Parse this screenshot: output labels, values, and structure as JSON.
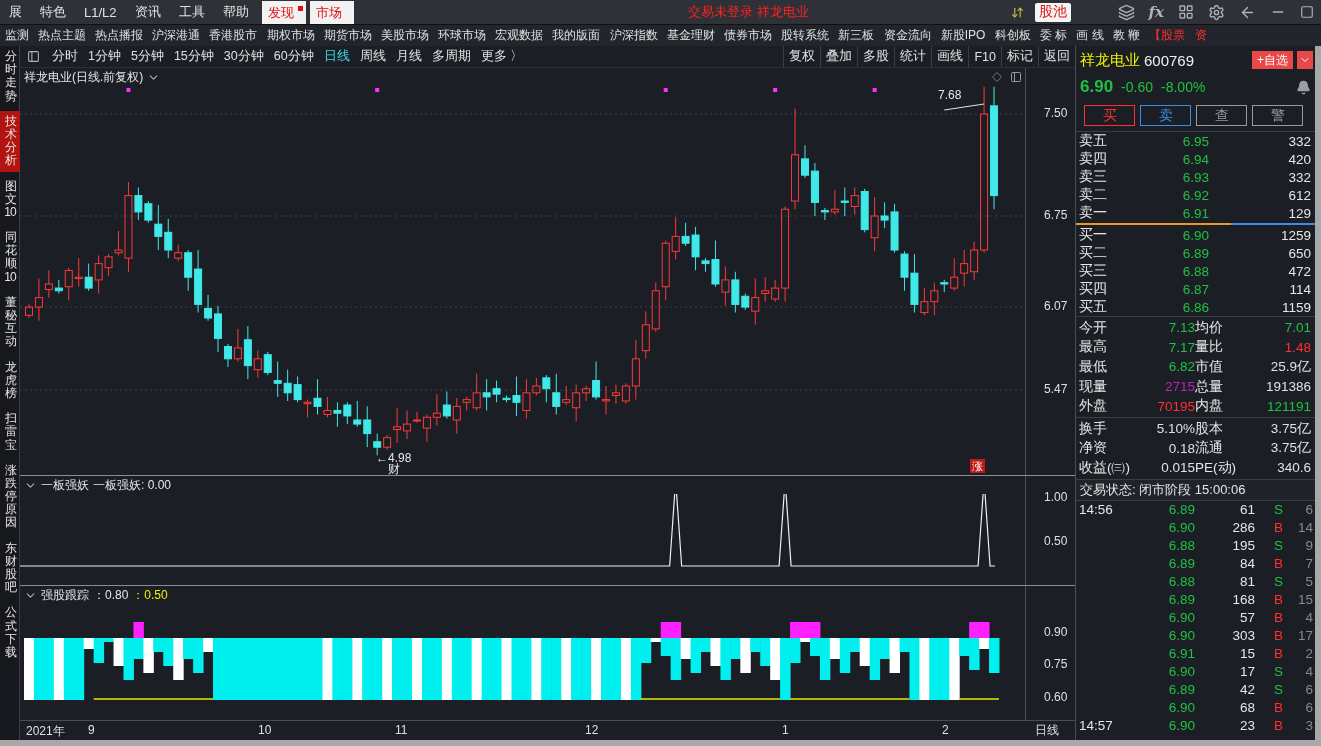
{
  "top_menu": {
    "items": [
      "展",
      "特色",
      "L1/L2",
      "资讯",
      "工具",
      "帮助"
    ],
    "tabs": [
      {
        "label": "发现",
        "badge": true
      },
      {
        "label": "市场",
        "badge": false
      }
    ],
    "title": "交易未登录  祥龙电业",
    "stock_pool": "股池",
    "formula_button": "fx"
  },
  "nav": [
    {
      "label": "监测",
      "highlighted": false
    },
    {
      "label": "热点主题",
      "highlighted": false
    },
    {
      "label": "热点播报",
      "highlighted": false
    },
    {
      "label": "沪深港通",
      "highlighted": false
    },
    {
      "label": "香港股市",
      "highlighted": false
    },
    {
      "label": "期权市场",
      "highlighted": false
    },
    {
      "label": "期货市场",
      "highlighted": false
    },
    {
      "label": "美股市场",
      "highlighted": false
    },
    {
      "label": "环球市场",
      "highlighted": false
    },
    {
      "label": "宏观数据",
      "highlighted": false
    },
    {
      "label": "我的版面",
      "highlighted": false
    },
    {
      "label": "沪深指数",
      "highlighted": false
    },
    {
      "label": "基金理财",
      "highlighted": false
    },
    {
      "label": "债券市场",
      "highlighted": false
    },
    {
      "label": "股转系统",
      "highlighted": false
    },
    {
      "label": "新三板",
      "highlighted": false
    },
    {
      "label": "资金流向",
      "highlighted": false
    },
    {
      "label": "新股IPO",
      "highlighted": false
    },
    {
      "label": "科创板",
      "highlighted": false
    },
    {
      "label": "委 标",
      "highlighted": false
    },
    {
      "label": "画 线",
      "highlighted": false
    },
    {
      "label": "教 鞭",
      "highlighted": false
    },
    {
      "label": "【股票",
      "highlighted": true
    },
    {
      "label": "资",
      "highlighted": true
    }
  ],
  "side_tabs": [
    {
      "label": "分时走势",
      "selected": false
    },
    {
      "label": "技术分析",
      "selected": true
    },
    {
      "label": "图文10",
      "selected": false
    },
    {
      "label": "同花顺10",
      "selected": false
    },
    {
      "label": "董秘互动",
      "selected": false
    },
    {
      "label": "龙虎榜",
      "selected": false
    },
    {
      "label": "扫雷宝",
      "selected": false
    },
    {
      "label": "涨跌停原因",
      "selected": false
    },
    {
      "label": "东财股吧",
      "selected": false
    },
    {
      "label": "公式下载",
      "selected": false
    }
  ],
  "periods": [
    {
      "label": "分时",
      "selected": false
    },
    {
      "label": "1分钟",
      "selected": false
    },
    {
      "label": "5分钟",
      "selected": false
    },
    {
      "label": "15分钟",
      "selected": false
    },
    {
      "label": "30分钟",
      "selected": false
    },
    {
      "label": "60分钟",
      "selected": false
    },
    {
      "label": "日线",
      "selected": true
    },
    {
      "label": "周线",
      "selected": false
    },
    {
      "label": "月线",
      "selected": false
    },
    {
      "label": "多周期",
      "selected": false
    },
    {
      "label": "更多 〉",
      "selected": false
    }
  ],
  "tools": [
    "复权",
    "叠加",
    "多股",
    "统计",
    "画线",
    "F10",
    "标记",
    "返回"
  ],
  "chart": {
    "title": "祥龙电业(日线.前复权)",
    "yticks": [
      "7.50",
      "6.75",
      "6.07",
      "5.47"
    ],
    "high_label": "7.68",
    "low_label": "←4.98",
    "event_mark": "财",
    "limit_badge": "涨"
  },
  "indicator1": {
    "name": "一板强妖",
    "reading": "一板强妖: 0.00",
    "yticks": [
      "1.00",
      "0.50"
    ]
  },
  "indicator2": {
    "name": "强股跟踪",
    "value_a": "：0.80",
    "value_b": "：0.50",
    "yticks": [
      "0.90",
      "0.75",
      "0.60"
    ]
  },
  "xaxis": {
    "labels": [
      "2021年",
      "9",
      "10",
      "11",
      "12",
      "1",
      "2"
    ],
    "period": "日线"
  },
  "quote": {
    "name": "祥龙电业",
    "code": "600769",
    "add_button": "+自选",
    "price": "6.90",
    "change": "-0.60",
    "change_pct": "-8.00%",
    "actions": [
      {
        "label": "买",
        "color": "#ff3030"
      },
      {
        "label": "卖",
        "color": "#3a8ee6"
      },
      {
        "label": "查",
        "color": "#9a9a9a"
      },
      {
        "label": "警",
        "color": "#9a9a9a"
      }
    ],
    "asks": [
      {
        "label": "卖五",
        "price": "6.95",
        "volume": "332"
      },
      {
        "label": "卖四",
        "price": "6.94",
        "volume": "420"
      },
      {
        "label": "卖三",
        "price": "6.93",
        "volume": "332"
      },
      {
        "label": "卖二",
        "price": "6.92",
        "volume": "612"
      },
      {
        "label": "卖一",
        "price": "6.91",
        "volume": "129"
      }
    ],
    "bids": [
      {
        "label": "买一",
        "price": "6.90",
        "volume": "1259"
      },
      {
        "label": "买二",
        "price": "6.89",
        "volume": "650"
      },
      {
        "label": "买三",
        "price": "6.88",
        "volume": "472"
      },
      {
        "label": "买四",
        "price": "6.87",
        "volume": "114"
      },
      {
        "label": "买五",
        "price": "6.86",
        "volume": "1159"
      }
    ],
    "stats": [
      [
        {
          "label": "今开",
          "value": "7.13",
          "color": "#20c040"
        },
        {
          "label": "均价",
          "value": "7.01",
          "color": "#20c040"
        }
      ],
      [
        {
          "label": "最高",
          "value": "7.17",
          "color": "#20c040"
        },
        {
          "label": "量比",
          "value": "1.48",
          "color": "#ff3030"
        }
      ],
      [
        {
          "label": "最低",
          "value": "6.82",
          "color": "#20c040"
        },
        {
          "label": "市值",
          "value": "25.9亿",
          "color": "#e0e0e0"
        }
      ],
      [
        {
          "label": "现量",
          "value": "2715",
          "color": "#c020c0"
        },
        {
          "label": "总量",
          "value": "191386",
          "color": "#e0e0e0"
        }
      ],
      [
        {
          "label": "外盘",
          "value": "70195",
          "color": "#ff3030"
        },
        {
          "label": "内盘",
          "value": "121191",
          "color": "#20c040"
        }
      ]
    ],
    "stats2": [
      [
        {
          "label": "换手",
          "value": "5.10%",
          "color": "#e0e0e0"
        },
        {
          "label": "股本",
          "value": "3.75亿",
          "color": "#e0e0e0"
        }
      ],
      [
        {
          "label": "净资",
          "value": "0.18",
          "color": "#e0e0e0"
        },
        {
          "label": "流通",
          "value": "3.75亿",
          "color": "#e0e0e0"
        }
      ],
      [
        {
          "label": "收益(㈢)",
          "value": "0.015",
          "color": "#e0e0e0"
        },
        {
          "label": "PE(动)",
          "value": "340.6",
          "color": "#e0e0e0"
        }
      ]
    ],
    "trade_status": "交易状态: 闭市阶段 15:00:06",
    "ticks": [
      {
        "time": "14:56",
        "price": "6.89",
        "volume": "61",
        "side": "S",
        "color": "#20c040",
        "count": "6"
      },
      {
        "price": "6.90",
        "volume": "286",
        "side": "B",
        "color": "#ff3030",
        "count": "14"
      },
      {
        "price": "6.88",
        "volume": "195",
        "side": "S",
        "color": "#20c040",
        "count": "9"
      },
      {
        "price": "6.89",
        "volume": "84",
        "side": "B",
        "color": "#ff3030",
        "count": "7"
      },
      {
        "price": "6.88",
        "volume": "81",
        "side": "S",
        "color": "#20c040",
        "count": "5"
      },
      {
        "price": "6.89",
        "volume": "168",
        "side": "B",
        "color": "#ff3030",
        "count": "15"
      },
      {
        "price": "6.90",
        "volume": "57",
        "side": "B",
        "color": "#ff3030",
        "count": "4"
      },
      {
        "price": "6.90",
        "volume": "303",
        "side": "B",
        "color": "#ff3030",
        "count": "17"
      },
      {
        "price": "6.91",
        "volume": "15",
        "side": "B",
        "color": "#ff3030",
        "count": "2"
      },
      {
        "price": "6.90",
        "volume": "17",
        "side": "S",
        "color": "#20c040",
        "count": "4"
      },
      {
        "price": "6.89",
        "volume": "42",
        "side": "S",
        "color": "#20c040",
        "count": "6"
      },
      {
        "price": "6.90",
        "volume": "68",
        "side": "B",
        "color": "#ff3030",
        "count": "6"
      },
      {
        "time": "14:57",
        "price": "6.90",
        "volume": "23",
        "side": "B",
        "color": "#ff3030",
        "count": "3"
      }
    ]
  }
}
